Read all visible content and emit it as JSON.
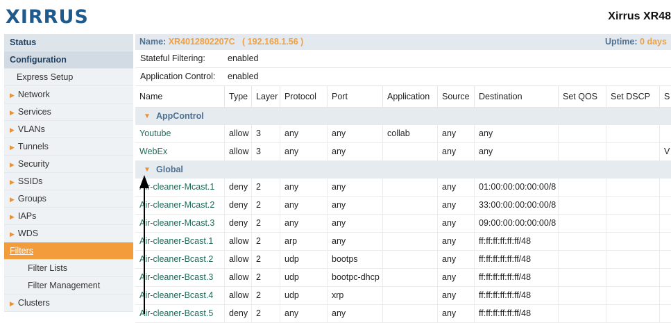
{
  "logo": "XIRRUS",
  "product_title": "Xirrus XR48",
  "sidebar": {
    "status": "Status",
    "configuration": "Configuration",
    "items": [
      {
        "label": "Express Setup",
        "type": "sub"
      },
      {
        "label": "Network",
        "type": "expand"
      },
      {
        "label": "Services",
        "type": "expand"
      },
      {
        "label": "VLANs",
        "type": "expand"
      },
      {
        "label": "Tunnels",
        "type": "expand"
      },
      {
        "label": "Security",
        "type": "expand"
      },
      {
        "label": "SSIDs",
        "type": "expand"
      },
      {
        "label": "Groups",
        "type": "expand"
      },
      {
        "label": "IAPs",
        "type": "expand"
      },
      {
        "label": "WDS",
        "type": "expand"
      },
      {
        "label": "Filters",
        "type": "active"
      },
      {
        "label": "Filter Lists",
        "type": "sub2"
      },
      {
        "label": "Filter Management",
        "type": "sub2"
      },
      {
        "label": "Clusters",
        "type": "expand"
      }
    ]
  },
  "namebar": {
    "name_label": "Name:",
    "name_value": "XR4012802207C   ( 192.168.1.56 )",
    "uptime_label": "Uptime:",
    "uptime_value": "0 days"
  },
  "settings": [
    {
      "key": "Stateful Filtering:",
      "value": "enabled"
    },
    {
      "key": "Application Control:",
      "value": "enabled"
    }
  ],
  "table": {
    "columns": [
      "Name",
      "Type",
      "Layer",
      "Protocol",
      "Port",
      "Application",
      "Source",
      "Destination",
      "Set QOS",
      "Set DSCP",
      "S"
    ],
    "groups": [
      {
        "name": "AppControl",
        "rows": [
          [
            "Youtube",
            "allow",
            "3",
            "any",
            "any",
            "collab",
            "any",
            "any",
            "",
            "",
            ""
          ],
          [
            "WebEx",
            "allow",
            "3",
            "any",
            "any",
            "",
            "any",
            "any",
            "",
            "",
            "V"
          ]
        ]
      },
      {
        "name": "Global",
        "rows": [
          [
            "Air-cleaner-Mcast.1",
            "deny",
            "2",
            "any",
            "any",
            "",
            "any",
            "01:00:00:00:00:00/8",
            "",
            "",
            ""
          ],
          [
            "Air-cleaner-Mcast.2",
            "deny",
            "2",
            "any",
            "any",
            "",
            "any",
            "33:00:00:00:00:00/8",
            "",
            "",
            ""
          ],
          [
            "Air-cleaner-Mcast.3",
            "deny",
            "2",
            "any",
            "any",
            "",
            "any",
            "09:00:00:00:00:00/8",
            "",
            "",
            ""
          ],
          [
            "Air-cleaner-Bcast.1",
            "allow",
            "2",
            "arp",
            "any",
            "",
            "any",
            "ff:ff:ff:ff:ff:ff/48",
            "",
            "",
            ""
          ],
          [
            "Air-cleaner-Bcast.2",
            "allow",
            "2",
            "udp",
            "bootps",
            "",
            "any",
            "ff:ff:ff:ff:ff:ff/48",
            "",
            "",
            ""
          ],
          [
            "Air-cleaner-Bcast.3",
            "allow",
            "2",
            "udp",
            "bootpc-dhcp",
            "",
            "any",
            "ff:ff:ff:ff:ff:ff/48",
            "",
            "",
            ""
          ],
          [
            "Air-cleaner-Bcast.4",
            "allow",
            "2",
            "udp",
            "xrp",
            "",
            "any",
            "ff:ff:ff:ff:ff:ff/48",
            "",
            "",
            ""
          ],
          [
            "Air-cleaner-Bcast.5",
            "deny",
            "2",
            "any",
            "any",
            "",
            "any",
            "ff:ff:ff:ff:ff:ff/48",
            "",
            "",
            ""
          ]
        ]
      }
    ]
  },
  "colors": {
    "accent": "#f29c3c",
    "brand": "#1f5a8c",
    "link": "#1f6b5a"
  }
}
